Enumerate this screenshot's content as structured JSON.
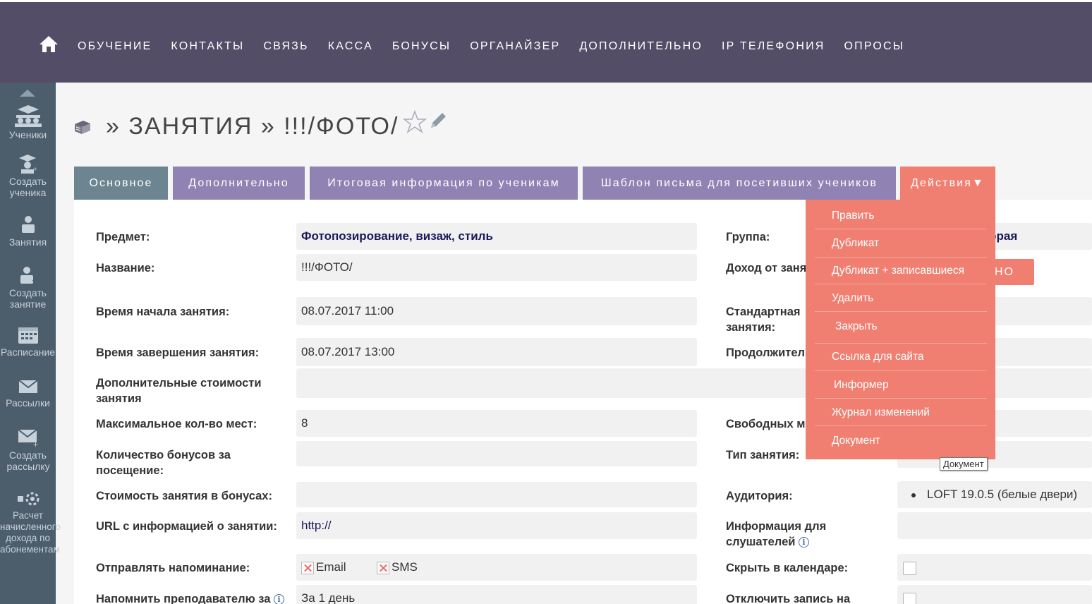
{
  "nav": {
    "items": [
      "ОБУЧЕНИЕ",
      "КОНТАКТЫ",
      "СВЯЗЬ",
      "КАССА",
      "БОНУСЫ",
      "ОРГАНАЙЗЕР",
      "ДОПОЛНИТЕЛЬНО",
      "IP ТЕЛЕФОНИЯ",
      "ОПРОСЫ"
    ]
  },
  "sidebar": {
    "items": [
      "Ученики",
      "Создать ученика",
      "Занятия",
      "Создать занятие",
      "Расписание",
      "Рассылки",
      "Создать рассылку",
      "Расчет начисленного дохода по абонементам"
    ]
  },
  "title": "» ЗАНЯТИЯ » !!!/ФОТО/",
  "tabs": [
    "Основное",
    "Дополнительно",
    "Итоговая информация по ученикам",
    "Шаблон письма для посетивших учеников",
    "Действия▼"
  ],
  "form": {
    "left": [
      {
        "label": "Предмет:",
        "value": "Фотопозирование, визаж, стиль"
      },
      {
        "label": "Название:",
        "value": "!!!/ФОТО/"
      },
      {
        "label": "Время начала занятия:",
        "value": "08.07.2017 11:00"
      },
      {
        "label": "Время завершения занятия:",
        "value": "08.07.2017 13:00"
      },
      {
        "label": "Дополнительные стоимости занятия",
        "value": ""
      },
      {
        "label": "Максимальное кол-во мест:",
        "value": "8"
      },
      {
        "label": "Количество бонусов за посещение:",
        "value": ""
      },
      {
        "label": "Стоимость занятия в бонусах:",
        "value": ""
      },
      {
        "label": "URL с информацией о занятии:",
        "value": "http://"
      },
      {
        "label": "Отправлять напоминание:",
        "value": ""
      },
      {
        "label": "Напомнить преподавателю за",
        "value": "За 1 день"
      }
    ],
    "remind_email": "Email",
    "remind_sms": "SMS",
    "right": [
      {
        "label": "Группа:",
        "value": "торая"
      },
      {
        "label": "Доход от заня",
        "value": ""
      },
      {
        "label": "Стандартная занятия:",
        "value": ""
      },
      {
        "label": "Продолжител",
        "value": ""
      },
      {
        "label": "Свободных м",
        "value": ""
      },
      {
        "label": "Тип занятия:",
        "value": ""
      },
      {
        "label": "Аудитория:",
        "value": "LOFT 19.0.5 (белые двери)"
      },
      {
        "label": "Информация для слушателей",
        "value": ""
      },
      {
        "label": "Скрыть в календаре:",
        "value": ""
      },
      {
        "label": "Отключить запись на",
        "value": ""
      }
    ],
    "save_fragment": "НО"
  },
  "actions_menu": [
    "Править",
    "Дубликат",
    "Дубликат + записавшиеся",
    "Удалить",
    "Закрыть",
    "Ссылка для сайта",
    "Информер",
    "Журнал изменений",
    "Документ"
  ],
  "tooltip": "Документ",
  "info_glyph": "i",
  "colors": {
    "topbar": "#534d68",
    "sidebar": "#4c5d6b",
    "tab_active": "#6d8590",
    "tab": "#9083b4",
    "accent": "#f07f71"
  }
}
